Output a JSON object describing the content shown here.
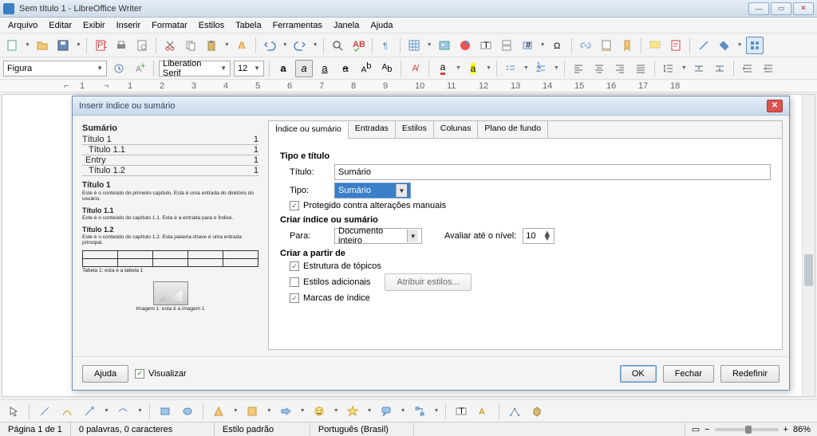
{
  "window": {
    "title": "Sem título 1 - LibreOffice Writer"
  },
  "menu": {
    "items": [
      "Arquivo",
      "Editar",
      "Exibir",
      "Inserir",
      "Formatar",
      "Estilos",
      "Tabela",
      "Ferramentas",
      "Janela",
      "Ajuda"
    ]
  },
  "toolbar2": {
    "style_name": "Figura",
    "font_name": "Liberation Serif",
    "font_size": "12"
  },
  "ruler": {
    "ticks": [
      "1",
      "2",
      "1",
      "2",
      "3",
      "4",
      "5",
      "6",
      "7",
      "8",
      "9",
      "10",
      "11",
      "12",
      "13",
      "14",
      "15",
      "16",
      "17",
      "18"
    ]
  },
  "dialog": {
    "title": "Inserir índice ou sumário",
    "tabs": [
      "Índice ou sumário",
      "Entradas",
      "Estilos",
      "Colunas",
      "Plano de fundo"
    ],
    "active_tab": 0,
    "section_type_title": "Tipo e título",
    "lbl_title": "Título:",
    "val_title": "Sumário",
    "lbl_type": "Tipo:",
    "val_type": "Sumário",
    "chk_protected": "Protegido contra alterações manuais",
    "section_create": "Criar índice ou sumário",
    "lbl_for": "Para:",
    "val_for": "Documento inteiro",
    "lbl_eval": "Avaliar até o nível:",
    "val_eval": "10",
    "section_from": "Criar a partir de",
    "chk_outline": "Estrutura de tópicos",
    "chk_addstyles": "Estilos adicionais",
    "btn_assign": "Atribuir estilos...",
    "chk_marks": "Marcas de índice",
    "btn_help": "Ajuda",
    "chk_preview": "Visualizar",
    "btn_ok": "OK",
    "btn_close": "Fechar",
    "btn_reset": "Redefinir",
    "preview": {
      "toc_header": "Sumário",
      "toc_lines": [
        [
          "Título 1",
          "1"
        ],
        [
          "Título 1.1",
          "1"
        ],
        [
          "Entry",
          "1"
        ],
        [
          "Título 1.2",
          "1"
        ]
      ],
      "h1": "Título 1",
      "p1": "Este é o conteúdo do primeiro capítulo. Esta é uma entrada do diretório do usuário.",
      "h11": "Título 1.1",
      "p11": "Este é o conteúdo do capítulo 1.1. Esta é a entrada para o Índice.",
      "h12": "Título 1.2",
      "p12": "Este é o conteúdo do capítulo 1.2. Esta palavra-chave é uma entrada principal.",
      "tbl_cap": "Tabela 1: esta é a tabela 1",
      "img_cap": "Imagem 1: esta é a imagem 1"
    }
  },
  "status": {
    "page": "Página 1 de 1",
    "words": "0 palavras, 0 caracteres",
    "style": "Estilo padrão",
    "lang": "Português (Brasil)",
    "zoom": "86%"
  }
}
